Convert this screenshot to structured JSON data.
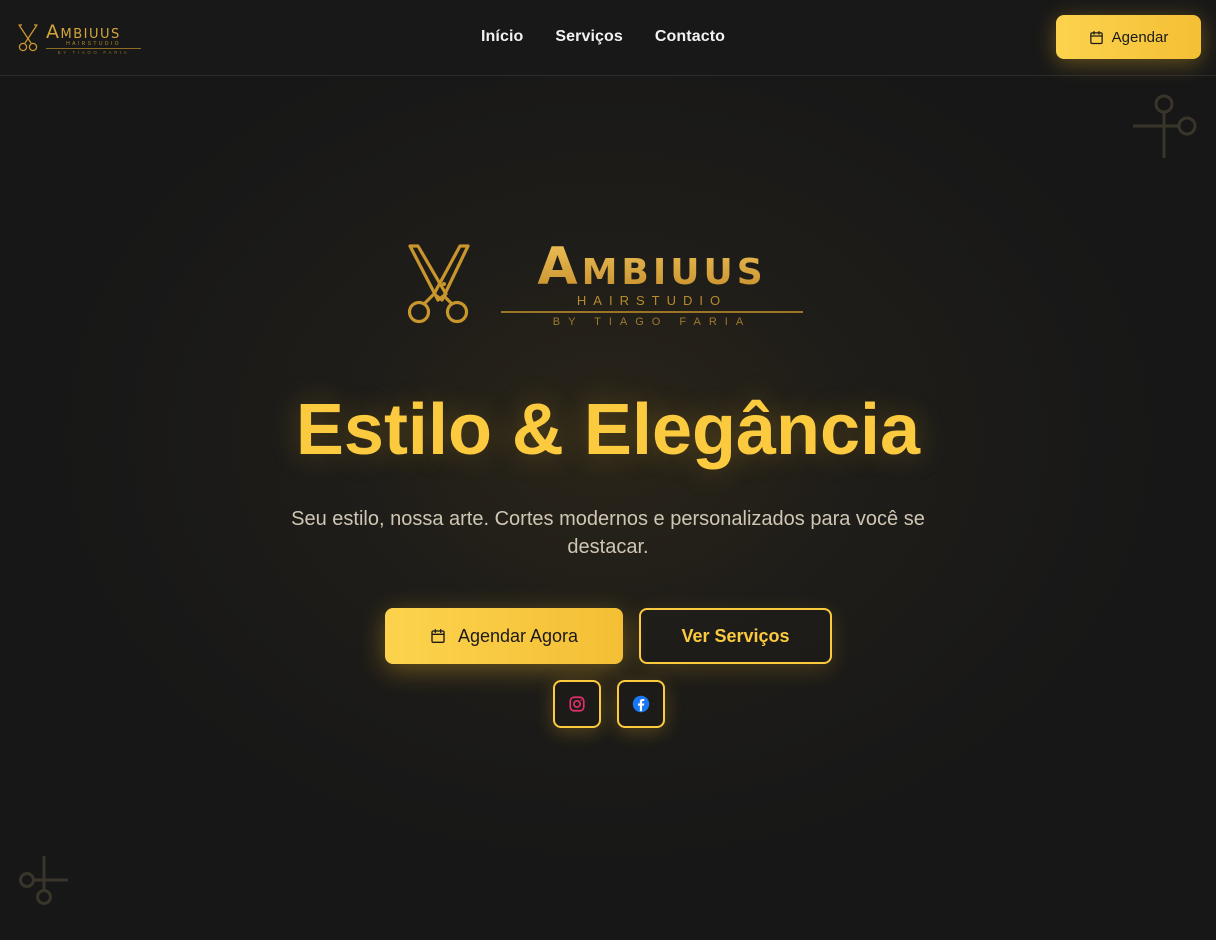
{
  "header": {
    "logo": {
      "name": "Ambiuus",
      "sub": "HAIRSTUDIO",
      "by": "BY TIAGO FARIA"
    },
    "nav": [
      {
        "label": "Início"
      },
      {
        "label": "Serviços"
      },
      {
        "label": "Contacto"
      }
    ],
    "cta_label": "Agendar"
  },
  "hero": {
    "logo": {
      "name": "Ambiuus",
      "sub": "HAIRSTUDIO",
      "by": "BY TIAGO FARIA"
    },
    "title": "Estilo & Elegância",
    "subtitle": "Seu estilo, nossa arte. Cortes modernos e personalizados para você se destacar.",
    "primary_label": "Agendar Agora",
    "secondary_label": "Ver Serviços",
    "social": [
      {
        "icon": "instagram-icon",
        "color": "#e1306c"
      },
      {
        "icon": "facebook-icon",
        "color": "#1877f2"
      }
    ]
  },
  "colors": {
    "accent": "#fbca3f",
    "background": "#171717",
    "logo_gold": "#d4a63a"
  }
}
